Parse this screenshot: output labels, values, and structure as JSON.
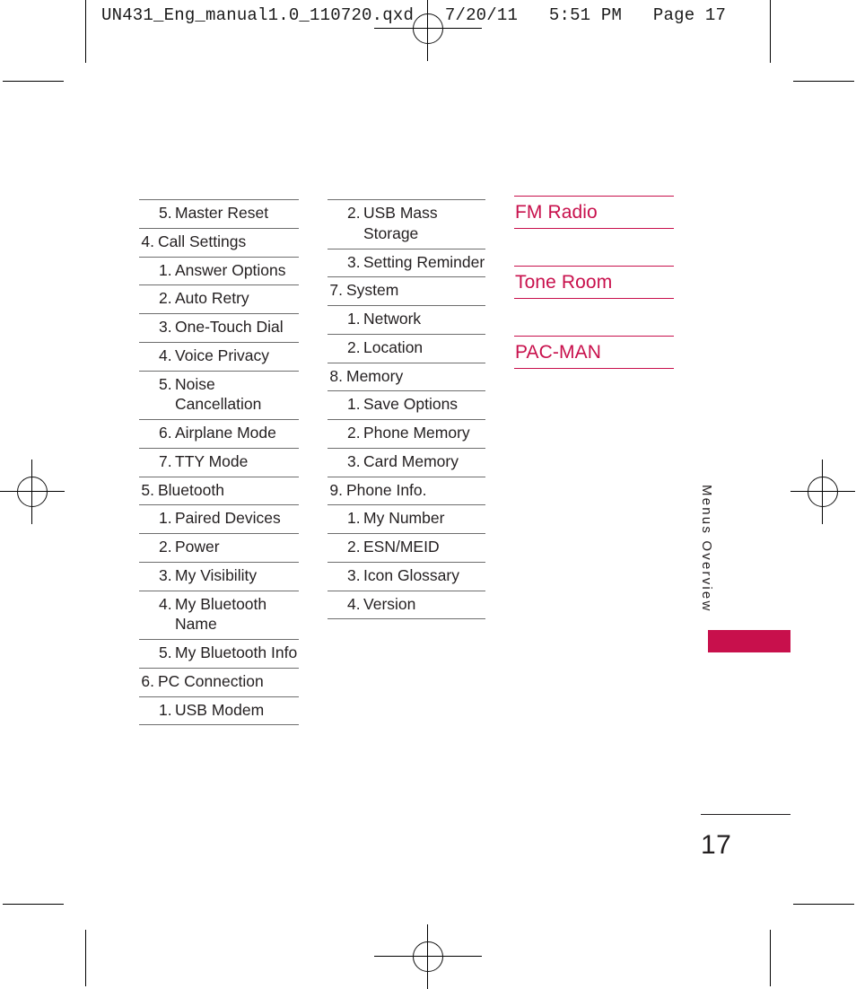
{
  "prepress": {
    "header_line": "UN431_Eng_manual1.0_110720.qxd   7/20/11   5:51 PM   Page 17"
  },
  "accent_color": "#c8104c",
  "text_color": "#231f20",
  "rule_color": "#6d6d6d",
  "running_head": "Menus Overview",
  "folio": "17",
  "columns": {
    "column_1": [
      {
        "num": "5.",
        "label": "Master Reset",
        "level": 2
      },
      {
        "num": "4.",
        "label": "Call Settings",
        "level": 1
      },
      {
        "num": "1.",
        "label": "Answer Options",
        "level": 2
      },
      {
        "num": "2.",
        "label": "Auto Retry",
        "level": 2
      },
      {
        "num": "3.",
        "label": "One-Touch Dial",
        "level": 2
      },
      {
        "num": "4.",
        "label": "Voice Privacy",
        "level": 2
      },
      {
        "num": "5.",
        "label": "Noise Cancellation",
        "level": 2
      },
      {
        "num": "6.",
        "label": "Airplane Mode",
        "level": 2
      },
      {
        "num": "7.",
        "label": "TTY Mode",
        "level": 2
      },
      {
        "num": "5.",
        "label": "Bluetooth",
        "level": 1
      },
      {
        "num": "1.",
        "label": "Paired Devices",
        "level": 2
      },
      {
        "num": "2.",
        "label": "Power",
        "level": 2
      },
      {
        "num": "3.",
        "label": "My Visibility",
        "level": 2
      },
      {
        "num": "4.",
        "label": "My Bluetooth Name",
        "level": 2
      },
      {
        "num": "5.",
        "label": "My Bluetooth Info",
        "level": 2
      },
      {
        "num": "6.",
        "label": "PC Connection",
        "level": 1
      },
      {
        "num": "1.",
        "label": "USB Modem",
        "level": 2
      }
    ],
    "column_2": [
      {
        "num": "2.",
        "label": "USB Mass Storage",
        "level": 2
      },
      {
        "num": "3.",
        "label": "Setting Reminder",
        "level": 2
      },
      {
        "num": "7.",
        "label": "System",
        "level": 1
      },
      {
        "num": "1.",
        "label": "Network",
        "level": 2
      },
      {
        "num": "2.",
        "label": "Location",
        "level": 2
      },
      {
        "num": "8.",
        "label": "Memory",
        "level": 1
      },
      {
        "num": "1.",
        "label": "Save Options",
        "level": 2
      },
      {
        "num": "2.",
        "label": "Phone Memory",
        "level": 2
      },
      {
        "num": "3.",
        "label": "Card Memory",
        "level": 2
      },
      {
        "num": "9.",
        "label": "Phone Info.",
        "level": 1
      },
      {
        "num": "1.",
        "label": "My Number",
        "level": 2
      },
      {
        "num": "2.",
        "label": "ESN/MEID",
        "level": 2
      },
      {
        "num": "3.",
        "label": "Icon Glossary",
        "level": 2
      },
      {
        "num": "4.",
        "label": "Version",
        "level": 2
      }
    ],
    "column_3": [
      {
        "label": "FM Radio"
      },
      {
        "label": "Tone Room"
      },
      {
        "label": "PAC-MAN"
      }
    ]
  }
}
